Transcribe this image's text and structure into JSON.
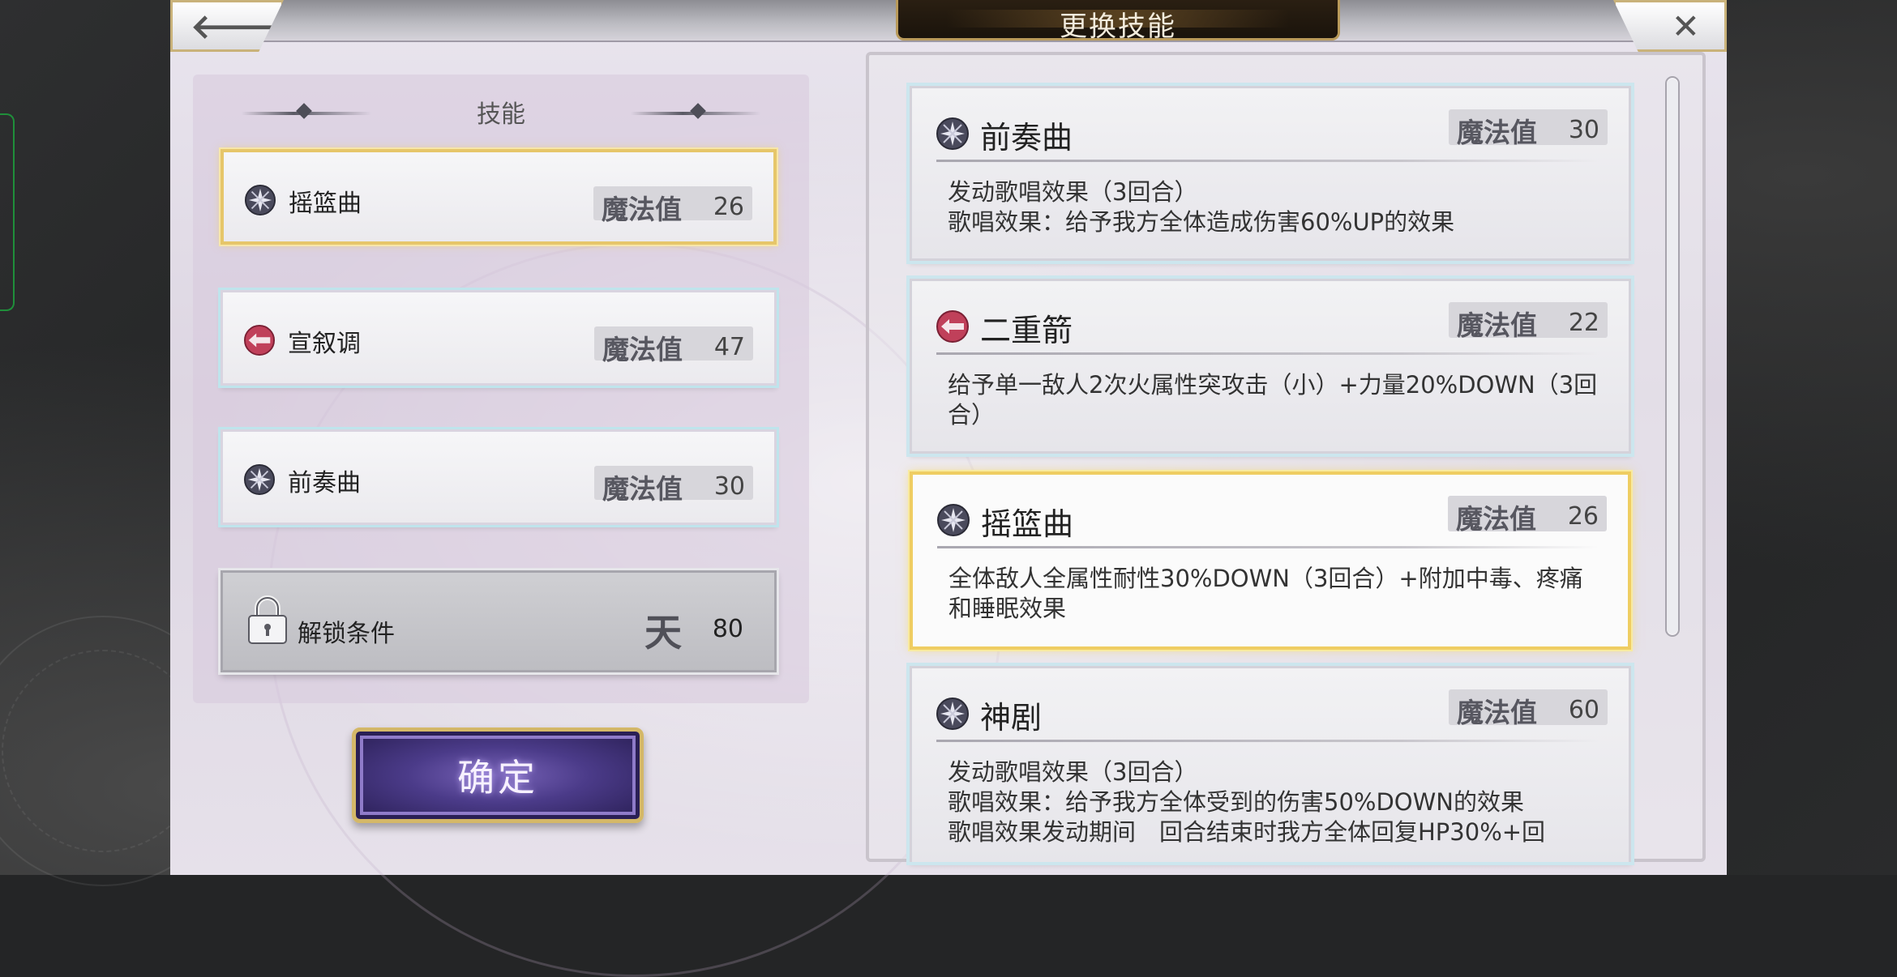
{
  "window": {
    "title": "更换技能"
  },
  "left_panel": {
    "header": "技能",
    "slots": [
      {
        "name": "摇篮曲",
        "mp_label": "魔法值",
        "mp": "26",
        "icon": "wind-crystal-icon",
        "selected": true
      },
      {
        "name": "宣叙调",
        "mp_label": "魔法值",
        "mp": "47",
        "icon": "fire-arrow-icon",
        "selected": false
      },
      {
        "name": "前奏曲",
        "mp_label": "魔法值",
        "mp": "30",
        "icon": "wind-crystal-icon",
        "selected": false
      }
    ],
    "locked_slot": {
      "label": "解锁条件",
      "rank_glyph": "天",
      "value": "80"
    },
    "confirm_label": "确定"
  },
  "skill_list": [
    {
      "name": "前奏曲",
      "mp_label": "魔法值",
      "mp": "30",
      "icon": "wind-crystal-icon",
      "description": "发动歌唱效果（3回合）\n歌唱效果：给予我方全体造成伤害60%UP的效果"
    },
    {
      "name": "二重箭",
      "mp_label": "魔法值",
      "mp": "22",
      "icon": "fire-arrow-icon",
      "description": "给予单一敌人2次火属性突攻击（小）+力量20%DOWN（3回合）"
    },
    {
      "name": "摇篮曲",
      "mp_label": "魔法值",
      "mp": "26",
      "icon": "wind-crystal-icon",
      "selected": true,
      "description": "全体敌人全属性耐性30%DOWN（3回合）+附加中毒、疼痛和睡眠效果"
    },
    {
      "name": "神剧",
      "mp_label": "魔法值",
      "mp": "60",
      "icon": "wind-crystal-icon",
      "description": "发动歌唱效果（3回合）\n歌唱效果：给予我方全体受到的伤害50%DOWN的效果\n歌唱效果发动期间　回合结束时我方全体回复HP30%+回"
    }
  ],
  "colors": {
    "selected_border": "#efcd62",
    "confirm_button": "#4b3b89",
    "fire_icon": "#c0405a",
    "wind_icon": "#5a5a6e"
  }
}
